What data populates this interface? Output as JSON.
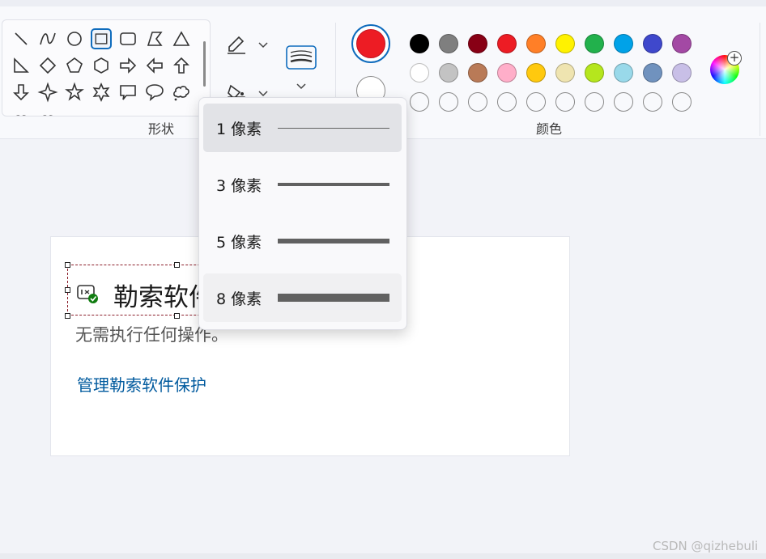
{
  "ribbon": {
    "shapes_group_label": "形状",
    "colors_group_label": "颜色",
    "shapes": [
      "line-shape",
      "curve-shape",
      "oval-shape",
      "rectangle-shape",
      "rounded-rectangle-shape",
      "polygon-shape",
      "triangle-shape",
      "right-triangle-shape",
      "diamond-shape",
      "pentagon-shape",
      "hexagon-shape",
      "right-arrow-shape",
      "left-arrow-shape",
      "up-arrow-shape",
      "down-arrow-shape",
      "four-point-star-shape",
      "five-point-star-shape",
      "six-point-star-shape",
      "rectangle-callout-shape",
      "oval-callout-shape",
      "cloud-callout-shape"
    ],
    "selected_shape": "rectangle-shape",
    "tools": {
      "outline_icon": "pencil-outline-icon",
      "fill_icon": "paint-bucket-icon",
      "size_icon": "line-size-icon"
    },
    "colors": {
      "primary": "#ed1c24",
      "secondary": "#ffffff",
      "palette_row1": [
        "#000000",
        "#7f7f7f",
        "#880015",
        "#ed1c24",
        "#ff7f27",
        "#fff200",
        "#22b14c",
        "#00a2e8",
        "#3f48cc",
        "#a349a4"
      ],
      "palette_row2": [
        "#ffffff",
        "#c3c3c3",
        "#b97a57",
        "#ffaec9",
        "#ffc90e",
        "#efe4b0",
        "#b5e61d",
        "#99d9ea",
        "#7092be",
        "#c8bfe7"
      ],
      "custom_slots": 10
    }
  },
  "dropdown": {
    "items": [
      {
        "label": "1 像素",
        "thickness": 1
      },
      {
        "label": "3 像素",
        "thickness": 3
      },
      {
        "label": "5 像素",
        "thickness": 5
      },
      {
        "label": "8 像素",
        "thickness": 8
      }
    ],
    "active_index": 0,
    "hover_index": 3
  },
  "canvas": {
    "title": "勒索软件",
    "subtitle": "无需执行任何操作。",
    "link": "管理勒索软件保护"
  },
  "watermark": "CSDN @qizhebuli"
}
